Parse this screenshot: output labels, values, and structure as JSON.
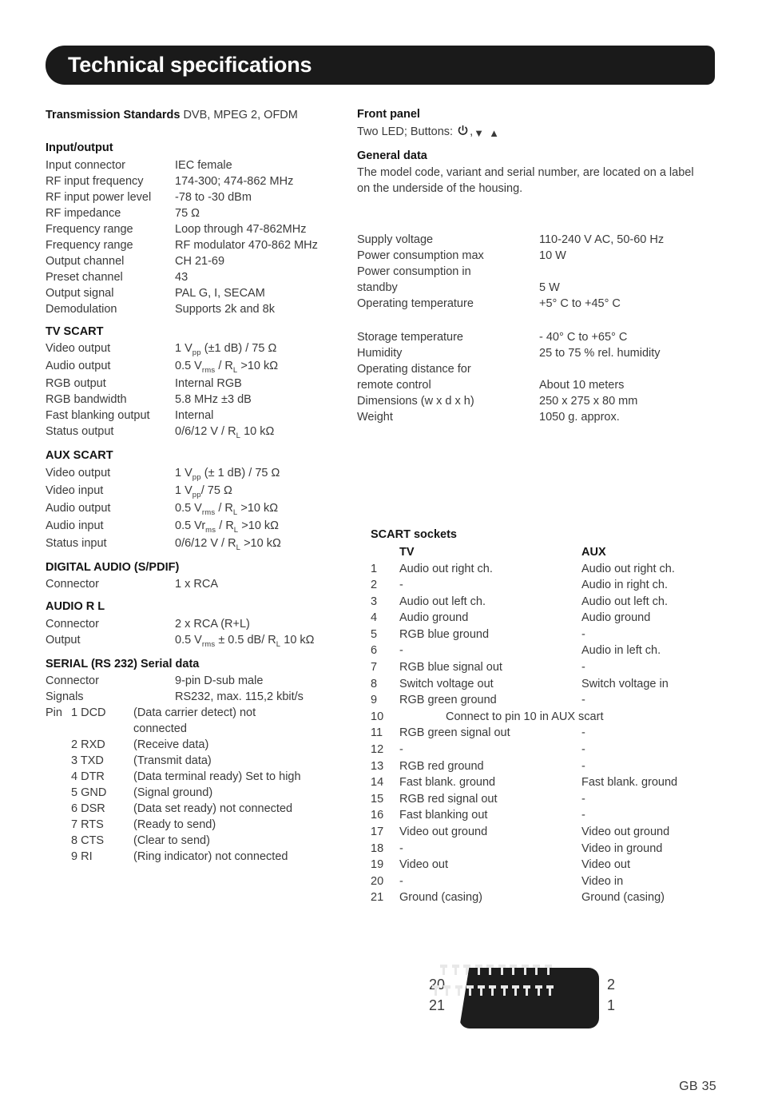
{
  "header": {
    "title": "Technical specifications"
  },
  "footer": {
    "page_label": "GB 35"
  },
  "left_column": {
    "transmission": {
      "label": "Transmission Standards",
      "value": "DVB, MPEG 2, OFDM"
    },
    "input_output": {
      "heading": "Input/output",
      "rows": [
        {
          "label": "Input connector",
          "value": "IEC female"
        },
        {
          "label": "RF input frequency",
          "value": "174-300; 474-862 MHz"
        },
        {
          "label": "RF input power level",
          "value": "-78 to -30 dBm"
        },
        {
          "label": "RF impedance",
          "value": "75 Ω"
        },
        {
          "label": "Frequency range",
          "value": "Loop through 47-862MHz"
        },
        {
          "label": "Frequency range",
          "value": "RF modulator 470-862 MHz"
        },
        {
          "label": "Output channel",
          "value": "CH 21-69"
        },
        {
          "label": "Preset channel",
          "value": "43"
        },
        {
          "label": "Output signal",
          "value": "PAL G, I, SECAM"
        },
        {
          "label": "Demodulation",
          "value": "Supports 2k and 8k"
        }
      ]
    },
    "tv_scart": {
      "heading": "TV SCART",
      "rows": [
        {
          "label": "Video output",
          "value_html": "1 V<sub>pp</sub> (±1 dB) / 75 Ω"
        },
        {
          "label": "Audio output",
          "value_html": "0.5 V<sub>rms</sub> / R<sub>L</sub> >10 kΩ"
        },
        {
          "label": "RGB output",
          "value_html": "Internal RGB"
        },
        {
          "label": "RGB bandwidth",
          "value_html": "5.8 MHz ±3 dB"
        },
        {
          "label": "Fast blanking output",
          "value_html": "Internal"
        },
        {
          "label": "Status output",
          "value_html": "0/6/12 V /  R<sub>L</sub> 10 kΩ"
        }
      ]
    },
    "aux_scart": {
      "heading": "AUX SCART",
      "rows": [
        {
          "label": "Video output",
          "value_html": "1 V<sub>pp</sub> (± 1 dB) / 75 Ω"
        },
        {
          "label": "Video input",
          "value_html": "1 V<sub>pp</sub>/ 75  Ω"
        },
        {
          "label": "Audio output",
          "value_html": "0.5 V<sub>rms</sub> / R<sub>L</sub> >10 kΩ"
        },
        {
          "label": "Audio input",
          "value_html": "0.5 Vr<sub>ms</sub> / R<sub>L</sub> >10 kΩ"
        },
        {
          "label": "Status input",
          "value_html": "0/6/12 V /  R<sub>L</sub> >10 kΩ"
        }
      ]
    },
    "digital_audio": {
      "heading": "DIGITAL AUDIO (S/PDIF)",
      "rows": [
        {
          "label": "Connector",
          "value_html": "1 x RCA"
        }
      ]
    },
    "audio_rl": {
      "heading": "AUDIO  R  L",
      "rows": [
        {
          "label": "Connector",
          "value_html": "2 x RCA (R+L)"
        },
        {
          "label": "Output",
          "value_html": "0.5 V<sub>rms</sub> ± 0.5 dB/ R<sub>L</sub> 10 kΩ"
        }
      ]
    },
    "serial": {
      "heading": "SERIAL (RS 232) Serial data",
      "rows": [
        {
          "label": "Connector",
          "value": "9-pin D-sub male"
        },
        {
          "label": "Signals",
          "value": "RS232, max. 115,2 kbit/s"
        }
      ],
      "pin_prefix": "Pin",
      "pins": [
        {
          "num": "1 DCD",
          "desc": "(Data carrier detect) not",
          "cont": "connected"
        },
        {
          "num": "2 RXD",
          "desc": "(Receive data)"
        },
        {
          "num": "3 TXD",
          "desc": "(Transmit data)"
        },
        {
          "num": "4 DTR",
          "desc": "(Data terminal ready) Set to high"
        },
        {
          "num": "5 GND",
          "desc": "(Signal ground)"
        },
        {
          "num": "6 DSR",
          "desc": "(Data set ready) not connected"
        },
        {
          "num": "7 RTS",
          "desc": "(Ready to send)"
        },
        {
          "num": "8 CTS",
          "desc": "(Clear to send)"
        },
        {
          "num": "9 RI",
          "desc": "(Ring indicator) not connected"
        }
      ]
    }
  },
  "right_column": {
    "front_panel": {
      "heading": "Front panel",
      "text_prefix": "Two LED; Buttons:",
      "icons": [
        "power-icon",
        "triangle-down-icon",
        "triangle-up-icon"
      ],
      "power_glyph": "⏻",
      "down_glyph": "▼",
      "up_glyph": "▲",
      "separator": ","
    },
    "general_data": {
      "heading": "General data",
      "text": "The model code, variant and serial number, are located on a label on the underside of the housing.",
      "rows_group1": [
        {
          "label": "Supply voltage",
          "value": "110-240 V AC, 50-60 Hz"
        },
        {
          "label": "Power consumption max",
          "value": "10 W"
        },
        {
          "label": "Power consumption in",
          "value": ""
        },
        {
          "label": "standby",
          "value": "5 W"
        },
        {
          "label": "Operating temperature",
          "value": "+5° C to +45° C"
        }
      ],
      "rows_group2": [
        {
          "label": "Storage temperature",
          "value": "- 40° C to +65° C"
        },
        {
          "label": "Humidity",
          "value": "25 to 75 % rel. humidity"
        },
        {
          "label": "Operating distance for",
          "value": ""
        },
        {
          "label": "remote control",
          "value": "About 10 meters"
        },
        {
          "label": "Dimensions (w x d x h)",
          "value": "250 x 275 x 80 mm"
        },
        {
          "label": "Weight",
          "value": "1050 g. approx."
        }
      ]
    },
    "scart_sockets": {
      "heading": "SCART sockets",
      "col_tv": "TV",
      "col_aux": "AUX",
      "rows": [
        {
          "num": "1",
          "tv": "Audio out  right ch.",
          "aux": "Audio out right ch."
        },
        {
          "num": "2",
          "tv": "-",
          "aux": "Audio in right ch."
        },
        {
          "num": "3",
          "tv": "Audio out left ch.",
          "aux": "Audio out left ch."
        },
        {
          "num": "4",
          "tv": "Audio ground",
          "aux": "Audio ground"
        },
        {
          "num": "5",
          "tv": " RGB blue ground",
          "aux": "-"
        },
        {
          "num": "6",
          "tv": "-",
          "aux": "Audio in left ch."
        },
        {
          "num": "7",
          "tv": "RGB blue signal out",
          "aux": "-"
        },
        {
          "num": "8",
          "tv": "Switch voltage out",
          "aux": "Switch voltage in"
        },
        {
          "num": "9",
          "tv": "RGB green  ground",
          "aux": "-"
        },
        {
          "num": "10",
          "span": "Connect to pin 10 in AUX scart"
        },
        {
          "num": "11",
          "tv": "RGB green signal out",
          "aux": "-"
        },
        {
          "num": "12",
          "tv": "-",
          "aux": "-"
        },
        {
          "num": "13",
          "tv": "RGB red ground",
          "aux": "-"
        },
        {
          "num": "14",
          "tv": "Fast blank. ground",
          "aux": "Fast blank. ground"
        },
        {
          "num": "15",
          "tv": "RGB red signal out",
          "aux": "-"
        },
        {
          "num": "16",
          "tv": "Fast blanking out",
          "aux": "-"
        },
        {
          "num": "17",
          "tv": "Video out ground",
          "aux": "Video out ground"
        },
        {
          "num": "18",
          "tv": " -",
          "aux": "Video in ground"
        },
        {
          "num": "19",
          "tv": "Video out",
          "aux": "Video out"
        },
        {
          "num": "20",
          "tv": "-",
          "aux": "Video in"
        },
        {
          "num": "21",
          "tv": "Ground (casing)",
          "aux": "Ground (casing)"
        }
      ]
    },
    "connector_diagram": {
      "name": "scart-connector-diagram",
      "label_top_left": "20",
      "label_bottom_left": "21",
      "label_top_right": "2",
      "label_bottom_right": "1",
      "top_row_pins": 10,
      "bottom_row_pins": 11
    }
  },
  "colors": {
    "header_bg": "#1a1a1a",
    "header_text": "#ffffff",
    "body_text": "#3a3a3a",
    "heading_text": "#141414",
    "connector_shell": "#1d1d1d",
    "connector_pin": "#e8e8e8"
  }
}
